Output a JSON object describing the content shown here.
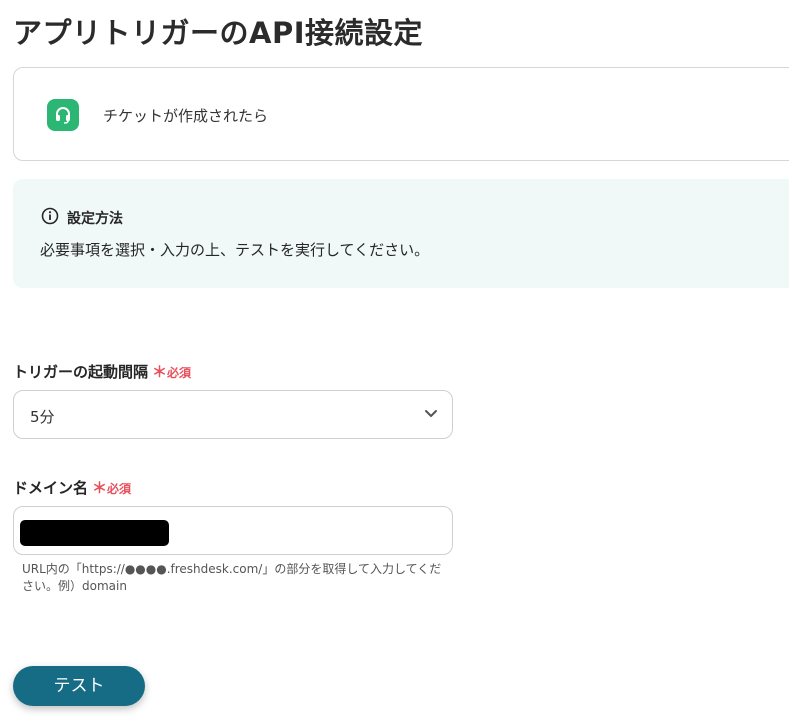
{
  "page": {
    "title": "アプリトリガーのAPI接続設定"
  },
  "trigger_card": {
    "label": "チケットが作成されたら",
    "icon": "headset-icon",
    "icon_color": "#2bb673"
  },
  "info": {
    "icon": "info-icon",
    "title": "設定方法",
    "body": "必要事項を選択・入力の上、テストを実行してください。",
    "background": "#f1f8f8"
  },
  "fields": {
    "interval": {
      "label": "トリガーの起動間隔",
      "required_mark": "＊",
      "required_text": "必須",
      "value": "5分"
    },
    "domain": {
      "label": "ドメイン名",
      "required_mark": "＊",
      "required_text": "必須",
      "help": "URL内の「https://●●●●.freshdesk.com/」の部分を取得して入力してください。例）domain"
    }
  },
  "actions": {
    "test_label": "テスト",
    "accent": "#166b85"
  },
  "colors": {
    "required": "#e8505b"
  }
}
